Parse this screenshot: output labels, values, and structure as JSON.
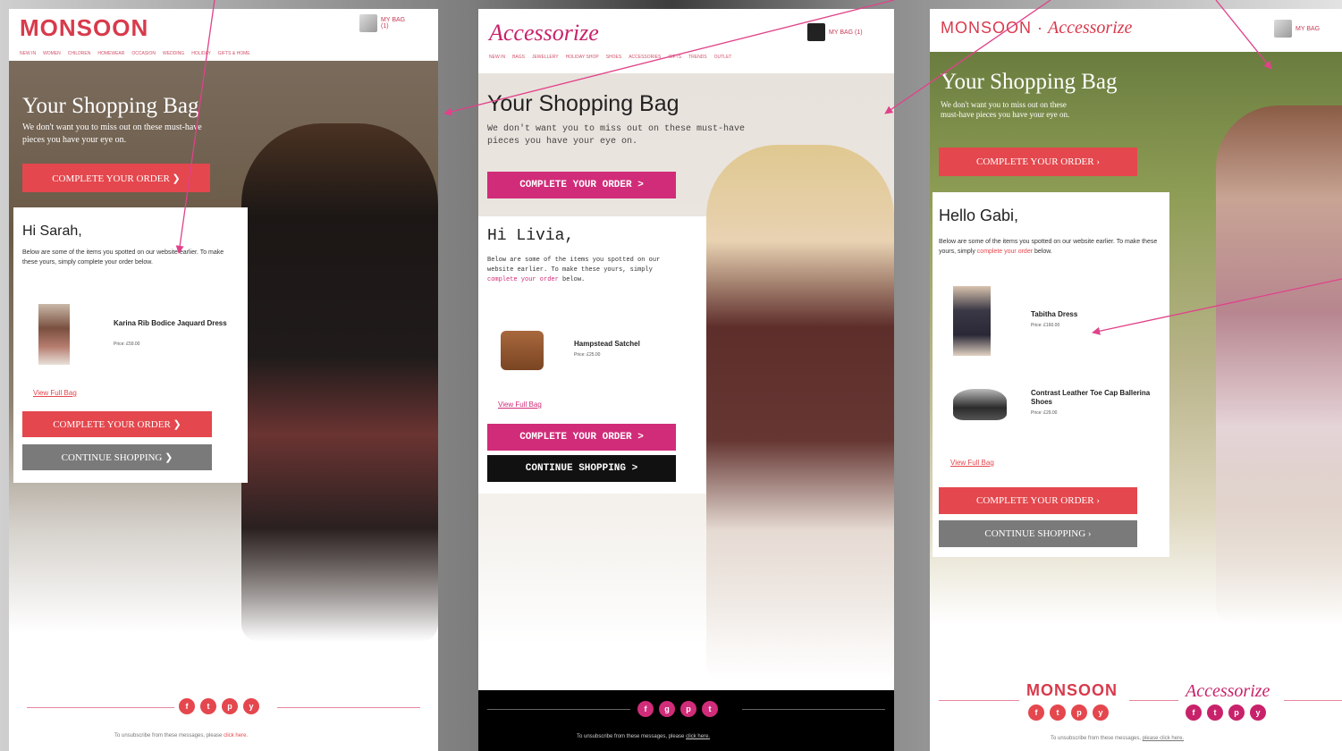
{
  "colors": {
    "monsoon_red": "#e4474d",
    "accessorize_pink": "#d12c79",
    "grey": "#7a7a7a",
    "arrow": "#e0428a"
  },
  "panel1": {
    "logo": "MONSOON",
    "bag": "MY BAG\n(1)",
    "nav": [
      "NEW IN",
      "WOMEN",
      "CHILDREN",
      "HOMEWEAR",
      "OCCASION",
      "WEDDING",
      "HOLIDAY",
      "GIFTS & HOME"
    ],
    "hero_title": "Your Shopping Bag",
    "hero_sub": "We don't want you to miss out on these must-have pieces you have your eye on.",
    "top_button": "COMPLETE YOUR ORDER  ❯",
    "greeting": "Hi Sarah,",
    "intro": "Below are some of the items you spotted on our website earlier. To make these yours, simply complete your order below.",
    "product": {
      "name": "Karina Rib Bodice Jaquard Dress",
      "price": "Price: £59.00"
    },
    "view_bag": "View Full Bag",
    "btn_complete": "COMPLETE YOUR ORDER  ❯",
    "btn_continue": "CONTINUE SHOPPING  ❯",
    "social": [
      "f",
      "t",
      "p",
      "y"
    ],
    "unsub_text": "To unsubscribe from these messages, please",
    "unsub_link": "click here."
  },
  "panel2": {
    "logo": "Accessorize",
    "bag": "MY BAG (1)",
    "nav": [
      "NEW IN",
      "BAGS",
      "JEWELLERY",
      "HOLIDAY SHOP",
      "SHOES",
      "ACCESSORIES",
      "GIFTS",
      "TRENDS",
      "OUTLET"
    ],
    "hero_title": "Your Shopping Bag",
    "hero_sub": "We don't want you to miss out on these must-have pieces you have your eye on.",
    "top_button": "COMPLETE YOUR ORDER >",
    "greeting": "Hi Livia,",
    "intro_a": "Below are some of the items you spotted on our website earlier. To make these yours, simply",
    "intro_link": "complete your order",
    "intro_b": "below.",
    "product": {
      "name": "Hampstead Satchel",
      "price": "Price: £25.00"
    },
    "view_bag": "View Full Bag",
    "btn_complete": "COMPLETE YOUR ORDER >",
    "btn_continue": "CONTINUE SHOPPING >",
    "social": [
      "f",
      "g",
      "p",
      "t"
    ],
    "unsub_text": "To unsubscribe from these messages, please",
    "unsub_link": "click here."
  },
  "panel3": {
    "logo_m": "MONSOON",
    "logo_dot": "·",
    "logo_a": "Accessorize",
    "bag": "MY BAG",
    "hero_title": "Your Shopping Bag",
    "hero_sub": "We don't want you to miss out on these must-have pieces you have your eye on.",
    "top_button": "COMPLETE YOUR ORDER  ›",
    "greeting": "Hello Gabi,",
    "intro_a": "Below are some of the items you spotted on our website earlier. To make these yours, simply",
    "intro_link": "complete your order",
    "intro_b": "below.",
    "product1": {
      "name": "Tabitha Dress",
      "price": "Price: £160.00"
    },
    "product2": {
      "name": "Contrast Leather Toe Cap Ballerina Shoes",
      "price": "Price: £29.00"
    },
    "view_bag": "View Full Bag",
    "btn_complete": "COMPLETE YOUR ORDER  ›",
    "btn_continue": "CONTINUE SHOPPING  ›",
    "footer_m": "MONSOON",
    "footer_a": "Accessorize",
    "social_m": [
      "f",
      "t",
      "p",
      "y"
    ],
    "social_a": [
      "f",
      "t",
      "p",
      "y"
    ],
    "unsub_text": "To unsubscribe from these messages,",
    "unsub_link": "please click here."
  }
}
